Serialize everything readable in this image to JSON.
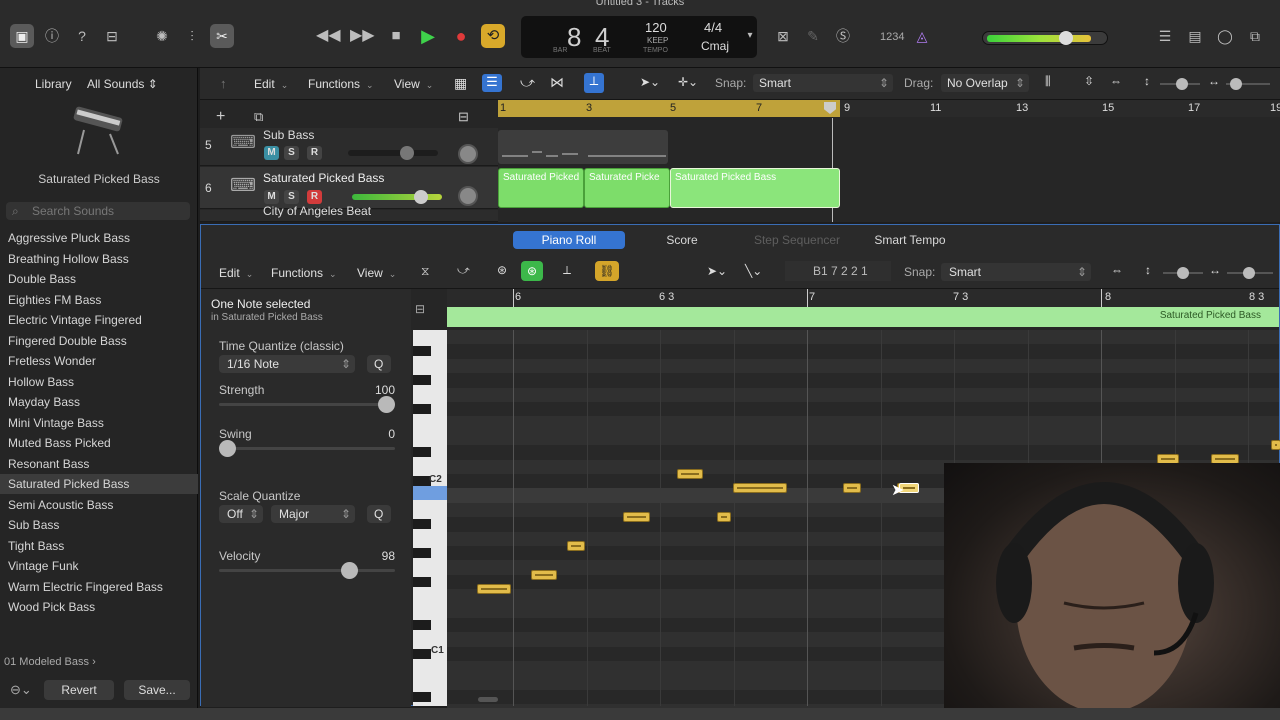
{
  "window_title": "Untitled 3 - Tracks",
  "control_bar": {
    "lcd": {
      "bar": "8",
      "beat": "4",
      "bar_label": "BAR",
      "beat_label": "BEAT",
      "tempo": "120",
      "keep": "KEEP",
      "tempo_label": "TEMPO",
      "signature": "4/4",
      "key": "Cmaj"
    },
    "count_in": "1234"
  },
  "library": {
    "title": "Library",
    "filter": "All Sounds",
    "patch_name": "Saturated Picked Bass",
    "search_placeholder": "Search Sounds",
    "items": [
      "Aggressive Pluck Bass",
      "Breathing Hollow Bass",
      "Double Bass",
      "Eighties FM Bass",
      "Electric Vintage Fingered",
      "Fingered Double Bass",
      "Fretless Wonder",
      "Hollow Bass",
      "Mayday Bass",
      "Mini Vintage Bass",
      "Muted Bass Picked",
      "Resonant Bass",
      "Saturated Picked Bass",
      "Semi Acoustic Bass",
      "Sub Bass",
      "Tight Bass",
      "Vintage Funk",
      "Warm Electric Fingered Bass",
      "Wood Pick Bass"
    ],
    "selected_index": 12,
    "folder": "01 Modeled Bass",
    "revert": "Revert",
    "save": "Save..."
  },
  "tracks_toolbar": {
    "edit": "Edit",
    "functions": "Functions",
    "view": "View",
    "snap_label": "Snap:",
    "snap_value": "Smart",
    "drag_label": "Drag:",
    "drag_value": "No Overlap"
  },
  "tracks_ruler": [
    "1",
    "3",
    "5",
    "7",
    "9",
    "11",
    "13",
    "15",
    "17",
    "19"
  ],
  "tracks": [
    {
      "number": "5",
      "name": "Sub Bass"
    },
    {
      "number": "6",
      "name": "Saturated Picked Bass"
    },
    {
      "number": "",
      "name": "City of Angeles Beat"
    }
  ],
  "track_buttons": {
    "m": "M",
    "s": "S",
    "r": "R"
  },
  "regions": [
    "Saturated Picked",
    "Saturated Picke",
    "Saturated Picked Bass"
  ],
  "piano_roll": {
    "tabs": [
      "Piano Roll",
      "Score",
      "Step Sequencer",
      "Smart Tempo"
    ],
    "selected_tab": 0,
    "edit": "Edit",
    "functions": "Functions",
    "view": "View",
    "position": "B1  7 2 2 1",
    "snap_label": "Snap:",
    "snap_value": "Smart",
    "selection_title": "One Note selected",
    "selection_sub": "in Saturated Picked Bass",
    "quantize_label": "Time Quantize (classic)",
    "quantize_value": "1/16 Note",
    "q": "Q",
    "strength_label": "Strength",
    "strength_value": "100",
    "strength_fraction": 1.0,
    "swing_label": "Swing",
    "swing_value": "0",
    "swing_fraction": 0.0,
    "scale_quantize_label": "Scale Quantize",
    "scale_off": "Off",
    "scale_mode": "Major",
    "velocity_label": "Velocity",
    "velocity_value": "98",
    "velocity_fraction": 0.77,
    "ruler": [
      "6",
      "6 3",
      "7",
      "7 3",
      "8",
      "8 3"
    ],
    "region_name": "Saturated Picked Bass",
    "key_c2": "C2",
    "key_c1": "C1"
  }
}
